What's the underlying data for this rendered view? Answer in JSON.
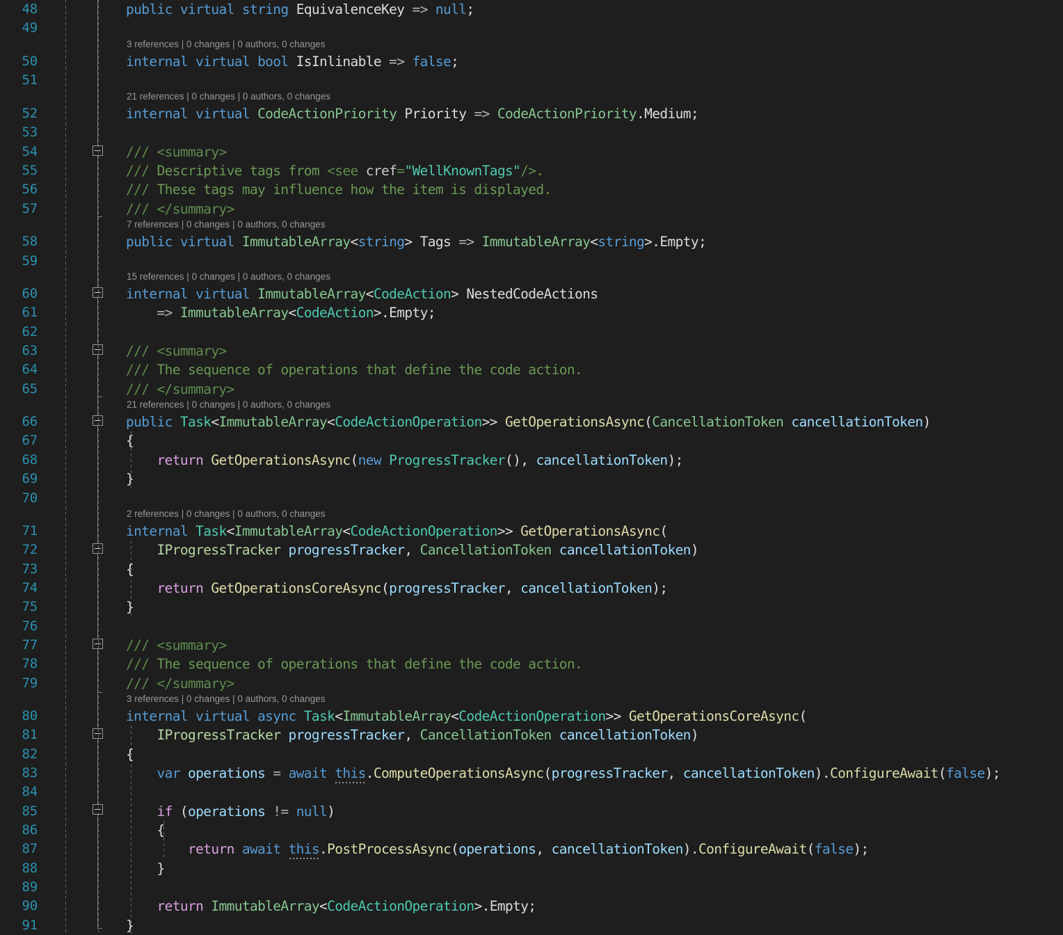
{
  "editor": {
    "theme": "Visual Studio Dark",
    "language": "C#",
    "background_color": "#1e1e1e",
    "line_number_color": "#2b91af",
    "codelens_color": "#999999",
    "first_visible_line": 48,
    "last_visible_line": 91
  },
  "line_numbers": [
    "48",
    "49",
    "50",
    "51",
    "52",
    "53",
    "54",
    "55",
    "56",
    "57",
    "58",
    "59",
    "60",
    "61",
    "62",
    "63",
    "64",
    "65",
    "66",
    "67",
    "68",
    "69",
    "70",
    "71",
    "72",
    "73",
    "74",
    "75",
    "76",
    "77",
    "78",
    "79",
    "80",
    "81",
    "82",
    "83",
    "84",
    "85",
    "86",
    "87",
    "88",
    "89",
    "90",
    "91"
  ],
  "codelens": [
    {
      "line": 50,
      "text": "3 references | 0 changes | 0 authors, 0 changes"
    },
    {
      "line": 52,
      "text": "21 references | 0 changes | 0 authors, 0 changes"
    },
    {
      "line": 58,
      "text": "7 references | 0 changes | 0 authors, 0 changes"
    },
    {
      "line": 60,
      "text": "15 references | 0 changes | 0 authors, 0 changes"
    },
    {
      "line": 66,
      "text": "21 references | 0 changes | 0 authors, 0 changes"
    },
    {
      "line": 71,
      "text": "2 references | 0 changes | 0 authors, 0 changes"
    },
    {
      "line": 80,
      "text": "3 references | 0 changes | 0 authors, 0 changes"
    }
  ],
  "code": {
    "l48": "public virtual string EquivalenceKey => null;",
    "l50": "internal virtual bool IsInlinable => false;",
    "l52": "internal virtual CodeActionPriority Priority => CodeActionPriority.Medium;",
    "l54": "/// <summary>",
    "l55": "/// Descriptive tags from <see cref=\"WellKnownTags\"/>.",
    "l56": "/// These tags may influence how the item is displayed.",
    "l57": "/// </summary>",
    "l58": "public virtual ImmutableArray<string> Tags => ImmutableArray<string>.Empty;",
    "l60": "internal virtual ImmutableArray<CodeAction> NestedCodeActions",
    "l61": "    => ImmutableArray<CodeAction>.Empty;",
    "l63": "/// <summary>",
    "l64": "/// The sequence of operations that define the code action.",
    "l65": "/// </summary>",
    "l66": "public Task<ImmutableArray<CodeActionOperation>> GetOperationsAsync(CancellationToken cancellationToken)",
    "l67": "{",
    "l68": "    return GetOperationsAsync(new ProgressTracker(), cancellationToken);",
    "l69": "}",
    "l71": "internal Task<ImmutableArray<CodeActionOperation>> GetOperationsAsync(",
    "l72": "    IProgressTracker progressTracker, CancellationToken cancellationToken)",
    "l73": "{",
    "l74": "    return GetOperationsCoreAsync(progressTracker, cancellationToken);",
    "l75": "}",
    "l77": "/// <summary>",
    "l78": "/// The sequence of operations that define the code action.",
    "l79": "/// </summary>",
    "l80": "internal virtual async Task<ImmutableArray<CodeActionOperation>> GetOperationsCoreAsync(",
    "l81": "    IProgressTracker progressTracker, CancellationToken cancellationToken)",
    "l82": "{",
    "l83": "    var operations = await this.ComputeOperationsAsync(progressTracker, cancellationToken).ConfigureAwait(false);",
    "l85": "    if (operations != null)",
    "l86": "    {",
    "l87": "        return await this.PostProcessAsync(operations, cancellationToken).ConfigureAwait(false);",
    "l88": "    }",
    "l90": "    return ImmutableArray<CodeActionOperation>.Empty;",
    "l91": "}"
  },
  "outlining": {
    "collapse_glyph": "minus-box",
    "collapsible_lines": [
      54,
      60,
      63,
      66,
      72,
      77,
      81,
      85
    ]
  }
}
